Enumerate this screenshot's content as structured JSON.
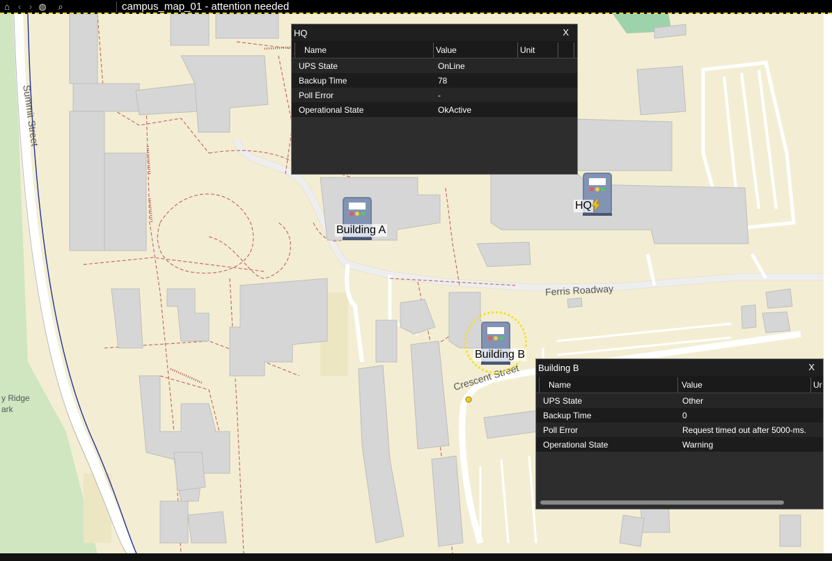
{
  "window": {
    "title": "campus_map_01 - attention needed"
  },
  "toolbar": {
    "home": "⌂",
    "back": "‹",
    "forward": "›",
    "globe": "◍",
    "search": "⌕"
  },
  "map_labels": {
    "summit_street": "Summit Street",
    "ferris_roadway": "Ferris Roadway",
    "crescent_street": "Crescent Street",
    "park_line1": "y Ridge",
    "park_line2": "ark"
  },
  "devices": {
    "building_a": {
      "label": "Building A",
      "status": "ok"
    },
    "hq": {
      "label": "HQ",
      "status": "on-battery"
    },
    "building_b": {
      "label": "Building B",
      "status": "warning"
    }
  },
  "hq_panel": {
    "title": "HQ",
    "close": "X",
    "columns": {
      "name": "Name",
      "value": "Value",
      "unit": "Unit"
    },
    "rows": [
      {
        "name": "UPS State",
        "value": "OnLine"
      },
      {
        "name": "Backup Time",
        "value": "78"
      },
      {
        "name": "Poll Error",
        "value": "-"
      },
      {
        "name": "Operational State",
        "value": "OkActive"
      }
    ]
  },
  "b_panel": {
    "title": "Building B",
    "close": "X",
    "columns": {
      "name": "Name",
      "value": "Value",
      "unit": "Ur"
    },
    "rows": [
      {
        "name": "UPS State",
        "value": "Other"
      },
      {
        "name": "Backup Time",
        "value": "0"
      },
      {
        "name": "Poll Error",
        "value": "Request timed out after 5000-ms."
      },
      {
        "name": "Operational State",
        "value": "Warning"
      }
    ]
  },
  "colors": {
    "warning_ring": "#f2e02a",
    "map_bg": "#f3eed3",
    "building": "#d9d9d9"
  }
}
